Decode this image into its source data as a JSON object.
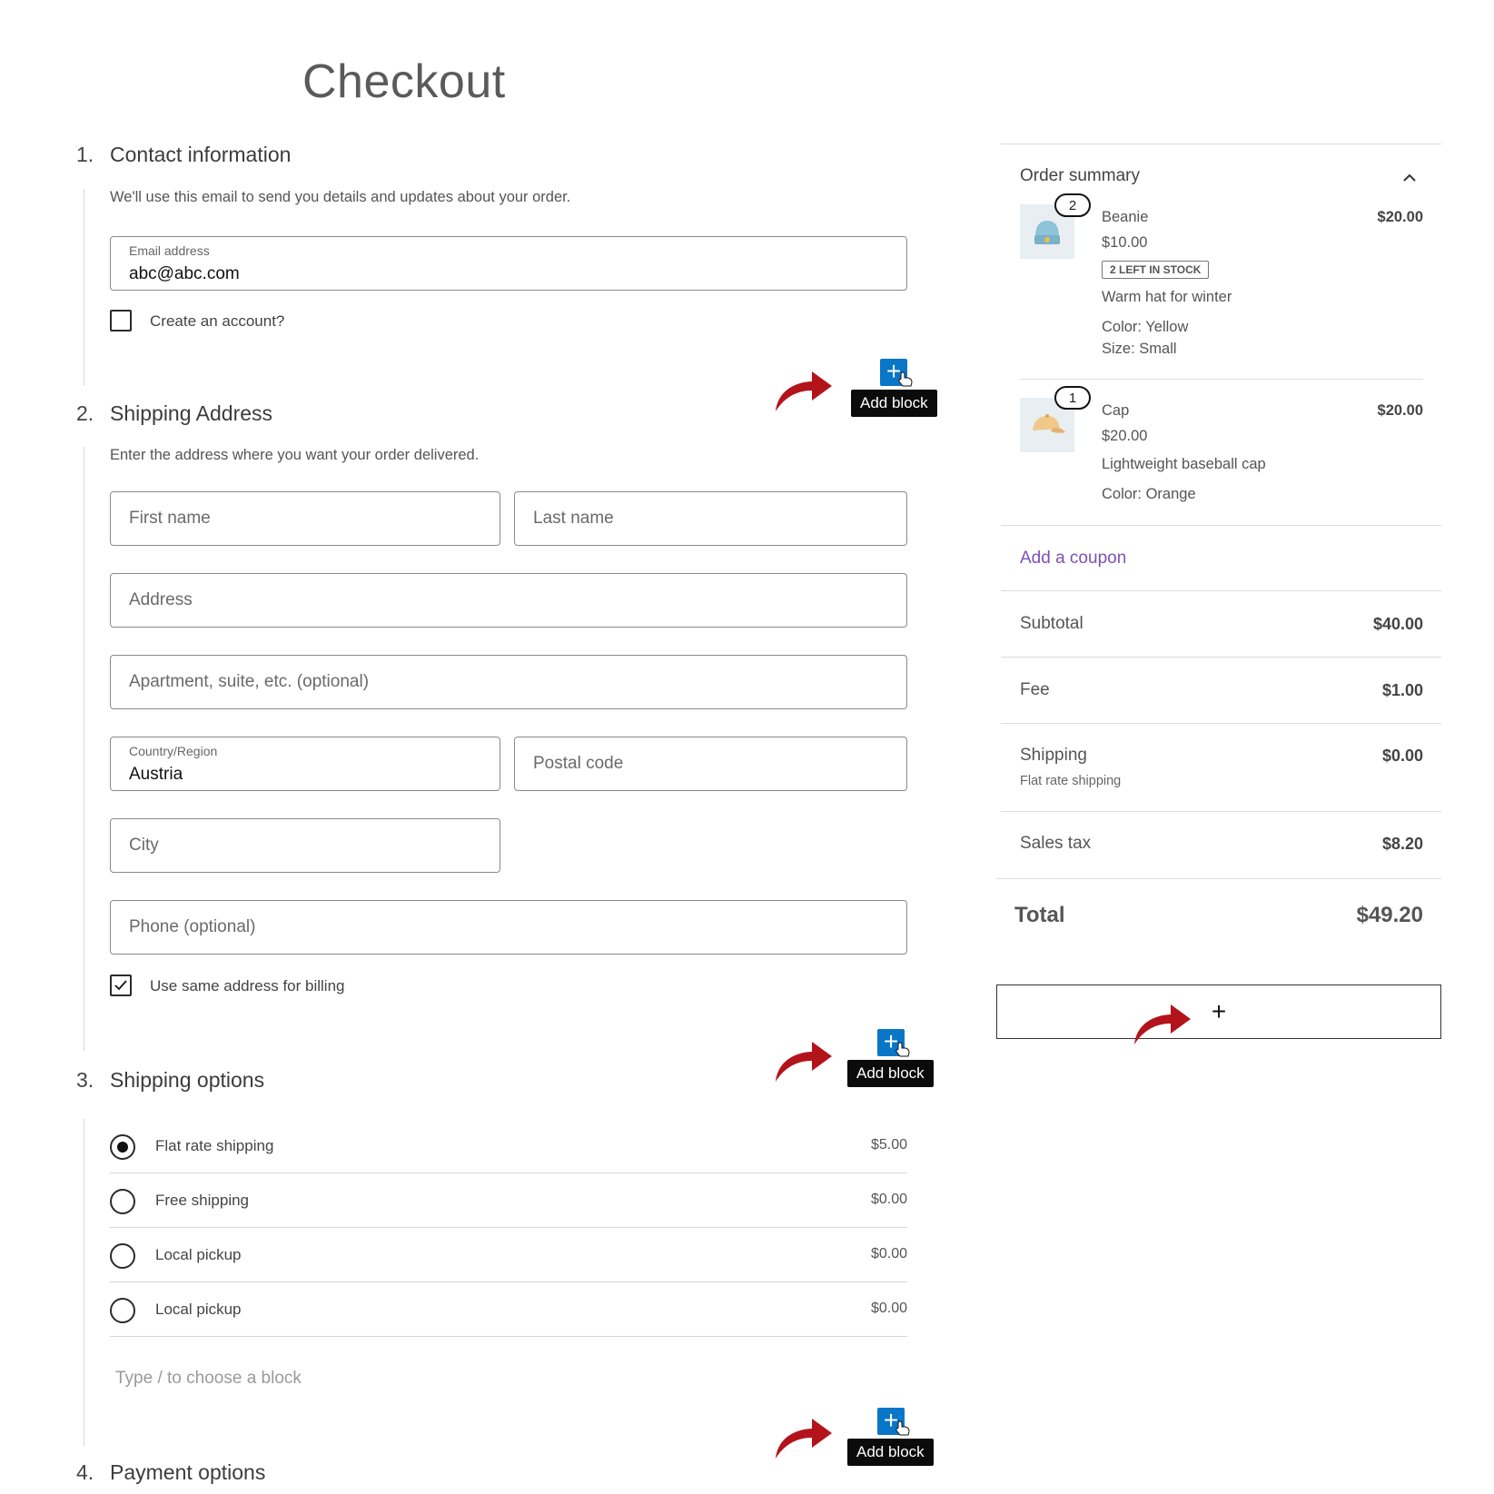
{
  "page": {
    "title": "Checkout"
  },
  "steps": {
    "contact": {
      "num": "1.",
      "title": "Contact information",
      "desc": "We'll use this email to send you details and updates about your order.",
      "email_label": "Email address",
      "email_value": "abc@abc.com",
      "create_account_label": "Create an account?"
    },
    "shipping_address": {
      "num": "2.",
      "title": "Shipping Address",
      "desc": "Enter the address where you want your order delivered.",
      "first_name_ph": "First name",
      "last_name_ph": "Last name",
      "address_ph": "Address",
      "apartment_ph": "Apartment, suite, etc. (optional)",
      "country_label": "Country/Region",
      "country_value": "Austria",
      "postal_ph": "Postal code",
      "city_ph": "City",
      "phone_ph": "Phone (optional)",
      "same_billing_label": "Use same address for billing"
    },
    "shipping_options": {
      "num": "3.",
      "title": "Shipping options",
      "options": [
        {
          "label": "Flat rate shipping",
          "price": "$5.00",
          "selected": true
        },
        {
          "label": "Free shipping",
          "price": "$0.00",
          "selected": false
        },
        {
          "label": "Local pickup",
          "price": "$0.00",
          "selected": false
        },
        {
          "label": "Local pickup",
          "price": "$0.00",
          "selected": false
        }
      ],
      "type_hint": "Type / to choose a block"
    },
    "payment": {
      "num": "4.",
      "title": "Payment options"
    }
  },
  "add_block": {
    "label": "Add block",
    "plus": "+"
  },
  "summary": {
    "title": "Order summary",
    "items": [
      {
        "qty": "2",
        "name": "Beanie",
        "unit_price": "$10.00",
        "stock": "2 LEFT IN STOCK",
        "desc": "Warm hat for winter",
        "meta1": "Color: Yellow",
        "meta2": "Size: Small",
        "price": "$20.00"
      },
      {
        "qty": "1",
        "name": "Cap",
        "unit_price": "$20.00",
        "desc": "Lightweight baseball cap",
        "meta1": "Color: Orange",
        "price": "$20.00"
      }
    ],
    "coupon": "Add a coupon",
    "subtotal_label": "Subtotal",
    "subtotal": "$40.00",
    "fee_label": "Fee",
    "fee": "$1.00",
    "shipping_label": "Shipping",
    "shipping": "$0.00",
    "shipping_method": "Flat rate shipping",
    "tax_label": "Sales tax",
    "tax": "$8.20",
    "total_label": "Total",
    "total": "$49.20",
    "appender_plus": "+"
  },
  "colors": {
    "accent_blue": "#0a76c7",
    "coupon_purple": "#7e4fb6",
    "arrow_red": "#b3141b"
  },
  "icons": [
    "plus-icon",
    "cursor-hand-icon",
    "chevron-up-icon",
    "arrow-icon",
    "beanie-icon",
    "cap-icon",
    "check-icon"
  ]
}
